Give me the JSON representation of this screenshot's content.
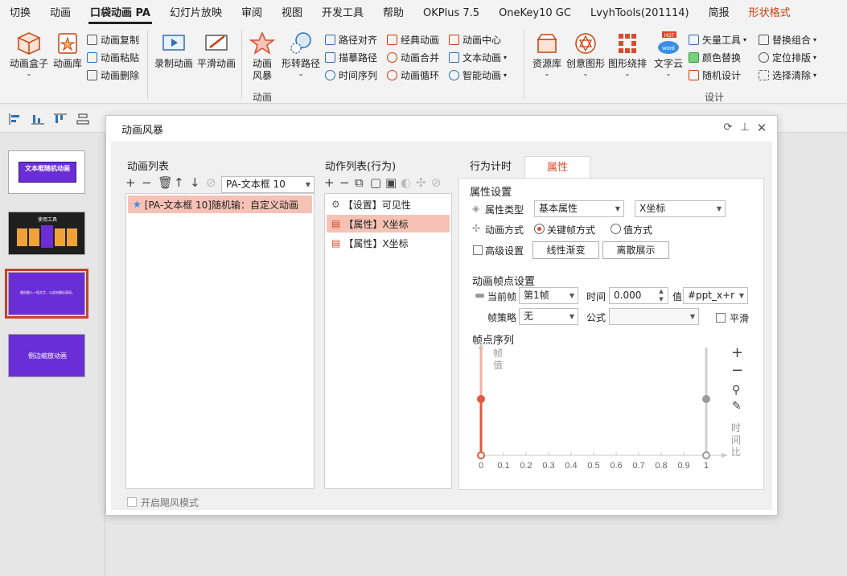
{
  "menu": {
    "tabs": [
      "切换",
      "动画",
      "口袋动画 PA",
      "幻灯片放映",
      "审阅",
      "视图",
      "开发工具",
      "帮助",
      "OKPlus 7.5",
      "OneKey10 GC",
      "LvyhTools(201114)",
      "简报",
      "形状格式"
    ]
  },
  "ribbon": {
    "box_label": "动画盒子",
    "lib_label": "动画库",
    "copy_label": "动画复制",
    "paste_label": "动画粘贴",
    "delete_label": "动画删除",
    "record_label": "录制动画",
    "smooth_label": "平滑动画",
    "storm_label": "动画风暴",
    "storm_line1": "动画",
    "storm_line2": "风暴",
    "shape_path_label": "形转路径",
    "path_align": "路径对齐",
    "trace_path": "描摹路径",
    "time_seq": "时间序列",
    "classic_anim": "经典动画",
    "anim_merge": "动画合并",
    "anim_loop": "动画循环",
    "anim_center": "动画中心",
    "text_anim": "文本动画",
    "smart_anim": "智能动画",
    "group_anim_label": "动画",
    "resource_label": "资源库",
    "creative_label": "创意图形",
    "arrange_label": "图形绕排",
    "wordcloud_label": "文字云",
    "hot_badge": "HOT",
    "word_badge": "word",
    "vector_tool": "矢量工具",
    "color_replace": "颜色替换",
    "random_design": "随机设计",
    "replace_group": "替换组合",
    "locate_arrange": "定位排版",
    "select_clear": "选择清除",
    "group_design_label": "设计"
  },
  "dialog": {
    "title": "动画风暴",
    "anim_list_title": "动画列表",
    "target_select": "PA-文本框 10",
    "anim_items": [
      "[PA-文本框 10]随机输：自定义动画"
    ],
    "action_list_title": "动作列表(行为)",
    "action_items": [
      "【设置】可见性",
      "【属性】X坐标",
      "【属性】X坐标"
    ],
    "tabs": [
      "行为计时",
      "属性"
    ],
    "prop_settings_title": "属性设置",
    "prop_type_label": "属性类型",
    "prop_type_value": "基本属性",
    "prop_sub_value": "X坐标",
    "anim_mode_label": "动画方式",
    "mode_keyframe": "关键帧方式",
    "mode_value": "值方式",
    "advanced_label": "高级设置",
    "linear_btn": "线性渐变",
    "discrete_btn": "离散展示",
    "frame_settings_title": "动画帧点设置",
    "current_frame_label": "当前帧",
    "current_frame_value": "第1帧",
    "time_label": "时间",
    "time_value": "0.000",
    "value_label": "值",
    "value_value": "#ppt_x+r",
    "strategy_label": "帧策略",
    "strategy_value": "无",
    "formula_label": "公式",
    "formula_value": "",
    "smooth_label": "平滑",
    "sequence_title": "帧点序列",
    "axis_y_label": "帧值",
    "axis_x_label": "时间比",
    "x_ticks": [
      "0",
      "0.1",
      "0.2",
      "0.3",
      "0.4",
      "0.5",
      "0.6",
      "0.7",
      "0.8",
      "0.9",
      "1"
    ],
    "storm_mode_label": "开启飓风模式"
  },
  "slides": {
    "s1_title": "文本框随机动画",
    "s2_title": "使用工具",
    "s3_text": "随机输入一段文字，以此给最佳表现。",
    "s4_title": "侧边缩放动画"
  },
  "colors": {
    "accent": "#d94a2c",
    "selection": "#f6c2b6",
    "purple": "#6b2ed6"
  }
}
